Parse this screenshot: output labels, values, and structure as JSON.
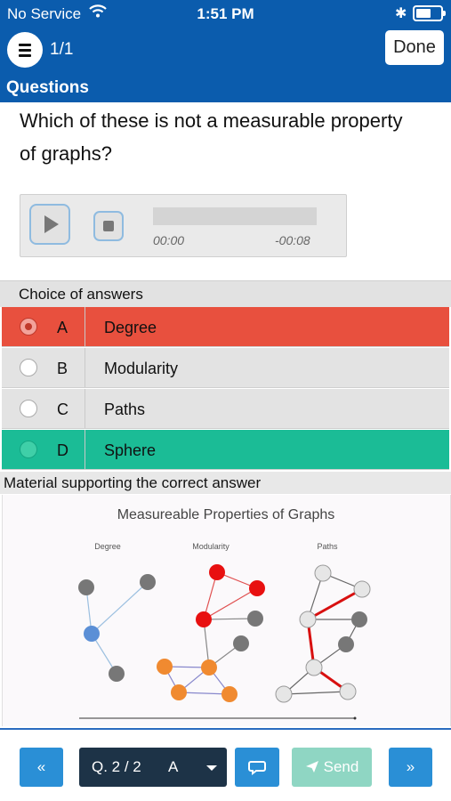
{
  "status_bar": {
    "carrier": "No Service",
    "time": "1:51 PM",
    "icons": [
      "wifi-icon",
      "bluetooth-icon",
      "battery-icon"
    ]
  },
  "nav": {
    "counter": "1/1",
    "done_label": "Done",
    "section_label": "Questions"
  },
  "question": {
    "text": "Which of these is not a measurable property of graphs?"
  },
  "audio": {
    "elapsed": "00:00",
    "remaining": "-00:08",
    "progress": 0
  },
  "answers": {
    "header": "Choice of answers",
    "items": [
      {
        "letter": "A",
        "text": "Degree",
        "state": "selected-wrong",
        "bg": "#e8503e"
      },
      {
        "letter": "B",
        "text": "Modularity",
        "state": "none",
        "bg": "#e3e3e3"
      },
      {
        "letter": "C",
        "text": "Paths",
        "state": "none",
        "bg": "#e3e3e3"
      },
      {
        "letter": "D",
        "text": "Sphere",
        "state": "correct",
        "bg": "#1bbc96"
      }
    ]
  },
  "material": {
    "header": "Material supporting the correct answer",
    "figure": {
      "title": "Measureable Properties of Graphs",
      "panels": [
        "Degree",
        "Modularity",
        "Paths"
      ]
    }
  },
  "toolbar": {
    "prev_icon": "«",
    "question_label": "Q. 2 / 2",
    "selected_answer": "A",
    "send_label": "Send",
    "next_icon": "»"
  },
  "colors": {
    "brand": "#0b5cad",
    "wrong": "#e8503e",
    "correct": "#1bbc96",
    "button_blue": "#2a8fd6",
    "send_disabled": "#8fd6c3",
    "dark": "#1d3347"
  }
}
